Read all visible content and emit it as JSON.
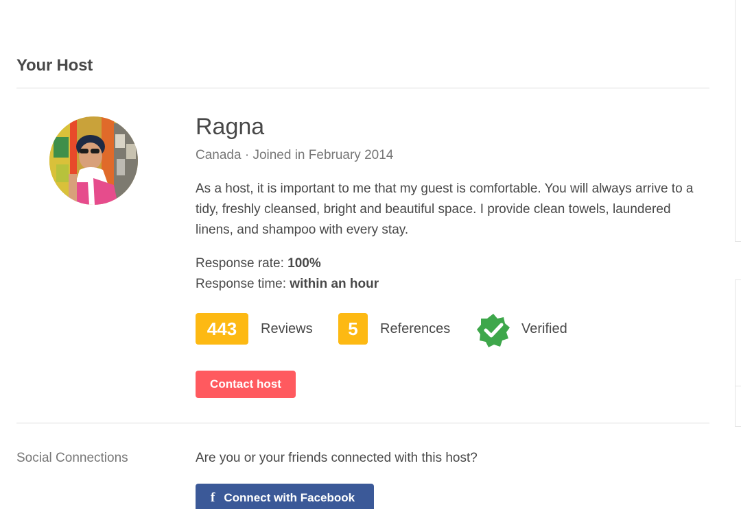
{
  "section": {
    "title": "Your Host"
  },
  "host": {
    "name": "Ragna",
    "meta": "Canada · Joined in February 2014",
    "about": "As a host, it is important to me that my guest is comfortable. You will always arrive to a tidy, freshly cleansed, bright and beautiful space. I provide clean towels, laundered linens, and shampoo with every stay.",
    "response_rate_label": "Response rate: ",
    "response_rate_value": "100%",
    "response_time_label": "Response time: ",
    "response_time_value": "within an hour"
  },
  "badges": {
    "reviews_count": "443",
    "reviews_label": "Reviews",
    "references_count": "5",
    "references_label": "References",
    "verified_label": "Verified",
    "verified_icon": "verified-badge-icon"
  },
  "actions": {
    "contact_label": "Contact host"
  },
  "social": {
    "label": "Social Connections",
    "question": "Are you or your friends connected with this host?",
    "facebook_icon": "f",
    "facebook_label": "Connect with Facebook"
  },
  "colors": {
    "badge": "#fdb913",
    "contact": "#ff5a5f",
    "facebook": "#3b5998",
    "verified": "#3ea74b"
  }
}
